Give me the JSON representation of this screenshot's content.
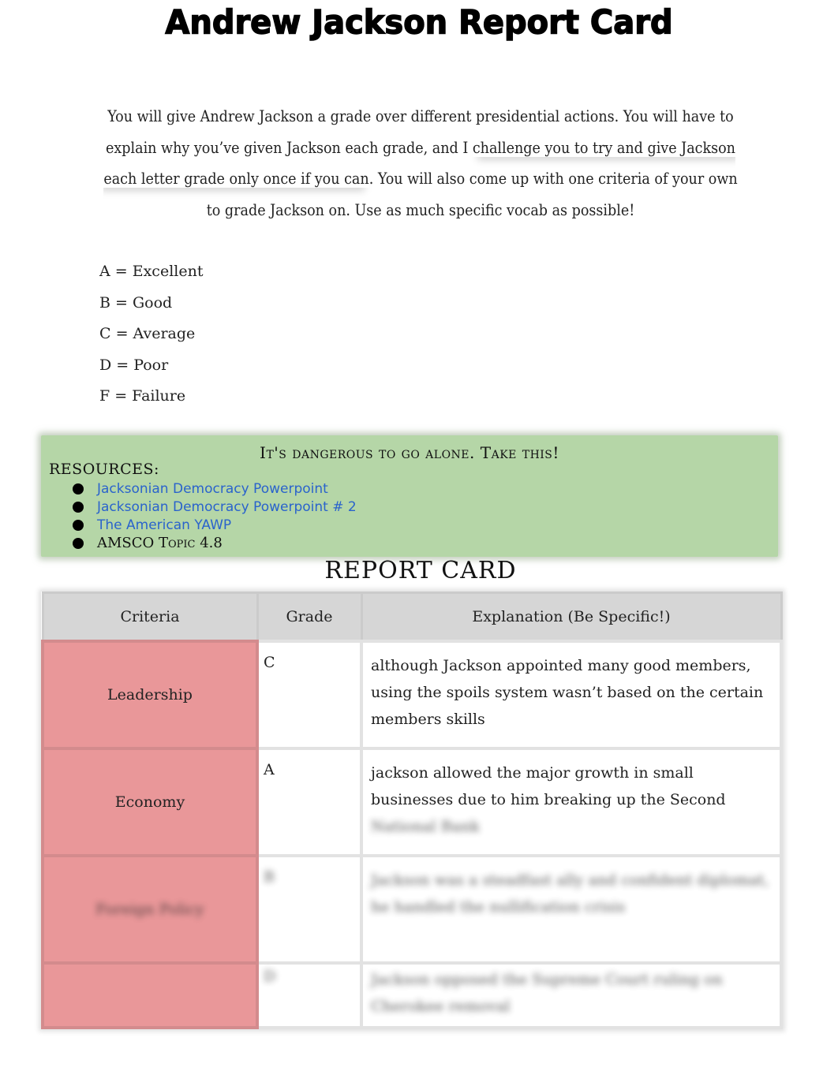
{
  "document": {
    "title": "Andrew Jackson Report Card",
    "intro": {
      "part1": "You will give Andrew Jackson a grade over different presidential actions. You will have to explain why you’ve given Jackson each grade, and I ",
      "highlighted": "challenge you to try and give Jackson each letter grade only once if you can",
      "part2": ". You will also come up with one criteria of your own to grade Jackson on. Use as much specific vocab as possible!"
    },
    "grade_scale": [
      "A = Excellent",
      "B = Good",
      "C = Average",
      "D = Poor",
      "F = Failure"
    ]
  },
  "resources": {
    "heading": "It's dangerous to go alone. Take this!",
    "label": "RESOURCES:",
    "items": [
      {
        "text": "Jacksonian Democracy Powerpoint",
        "link": true
      },
      {
        "text": "Jacksonian Democracy Powerpoint # 2",
        "link": true
      },
      {
        "text": "The American YAWP",
        "link": true
      },
      {
        "text": "AMSCO Topic 4.8",
        "link": false
      }
    ],
    "colors": {
      "background": "#b5d6a7",
      "link": "#2a63cc"
    }
  },
  "report_card": {
    "title": "REPORT CARD",
    "columns": [
      "Criteria",
      "Grade",
      "Explanation (Be Specific!)"
    ],
    "rows": [
      {
        "criteria": "Leadership",
        "grade": "C",
        "explanation": "although Jackson appointed many good members, using the spoils system wasn’t based on the certain members skills",
        "blurred": false
      },
      {
        "criteria": "Economy",
        "grade": "A",
        "explanation": "jackson allowed the major growth in small businesses due to him breaking up the Second",
        "explanation_blurred_tail": "National Bank",
        "blurred": false
      },
      {
        "criteria": "Foreign Policy",
        "grade": "B",
        "explanation": "Jackson was a steadfast ally and confident diplomat, he handled the nullification crisis",
        "blurred": true
      },
      {
        "criteria": "",
        "grade": "D",
        "explanation": "Jackson opposed the Supreme Court ruling on Cherokee removal",
        "blurred": true
      }
    ],
    "colors": {
      "criteria_cell": "#e99799",
      "header": "#d6d6d6"
    }
  }
}
